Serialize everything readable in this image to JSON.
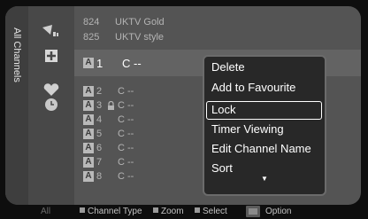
{
  "tab": {
    "label": "All Channels"
  },
  "channels_top": [
    {
      "number": "824",
      "name": "UKTV Gold"
    },
    {
      "number": "825",
      "name": "UKTV style"
    }
  ],
  "selected_channel": {
    "badge": "A",
    "number": "1",
    "name": "C --"
  },
  "channels": [
    {
      "badge": "A",
      "number": "2",
      "name": "C --",
      "locked": false
    },
    {
      "badge": "A",
      "number": "3",
      "name": "C --",
      "locked": true
    },
    {
      "badge": "A",
      "number": "4",
      "name": "C --",
      "locked": false
    },
    {
      "badge": "A",
      "number": "5",
      "name": "C --",
      "locked": false
    },
    {
      "badge": "A",
      "number": "6",
      "name": "C --",
      "locked": false
    },
    {
      "badge": "A",
      "number": "7",
      "name": "C --",
      "locked": false
    },
    {
      "badge": "A",
      "number": "8",
      "name": "C --",
      "locked": false
    }
  ],
  "menu": {
    "items": [
      "Delete",
      "Add to Favourite",
      "Lock",
      "Timer Viewing",
      "Edit Channel Name",
      "Sort"
    ],
    "selected_index": 2,
    "scroll_indicator": "▼"
  },
  "footer": {
    "tab": "All",
    "channel_type": "Channel Type",
    "zoom": "Zoom",
    "select": "Select",
    "option": "Option"
  },
  "icons": [
    "antenna-icon",
    "star-plus-icon",
    "heart-icon",
    "clock-icon",
    "lock-icon",
    "tools-icon"
  ]
}
